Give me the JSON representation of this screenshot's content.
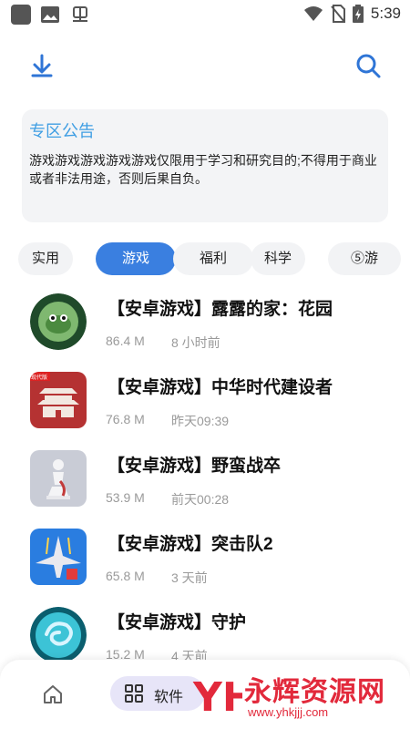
{
  "status_bar": {
    "time": "5:39"
  },
  "notice": {
    "title": "专区公告",
    "body": "游戏游戏游戏游戏游戏仅限用于学习和研究目的;不得用于商业或者非法用途，否则后果自负。"
  },
  "tabs": [
    {
      "label": "实用",
      "active": false
    },
    {
      "label": "游戏",
      "active": true
    },
    {
      "label": "福利",
      "active": false
    },
    {
      "label": "科学",
      "active": false
    },
    {
      "label": "⑤游",
      "active": false
    }
  ],
  "apps": [
    {
      "title": "【安卓游戏】露露的家：花园",
      "size": "86.4 M",
      "time": "8 小时前",
      "icon": "frog-plant-icon"
    },
    {
      "title": "【安卓游戏】中华时代建设者",
      "size": "76.8 M",
      "time": "昨天09:39",
      "icon": "chinese-palace-icon"
    },
    {
      "title": "【安卓游戏】野蛮战卒",
      "size": "53.9 M",
      "time": "前天00:28",
      "icon": "chess-pawn-icon"
    },
    {
      "title": "【安卓游戏】突击队2",
      "size": "65.8 M",
      "time": "3 天前",
      "icon": "fighter-plane-icon"
    },
    {
      "title": "【安卓游戏】守护",
      "size": "15.2 M",
      "time": "4 天前",
      "icon": "swirl-orb-icon"
    }
  ],
  "palace_badge": "现代版",
  "bottom_nav": {
    "software_label": "软件",
    "watermark_title": "永辉资源网",
    "watermark_url": "www.yhkjjj.com",
    "watermark_logo": "YH"
  },
  "colors": {
    "accent": "#3a7fe0",
    "notice_title": "#3f9ee3",
    "watermark": "#e2293b"
  }
}
